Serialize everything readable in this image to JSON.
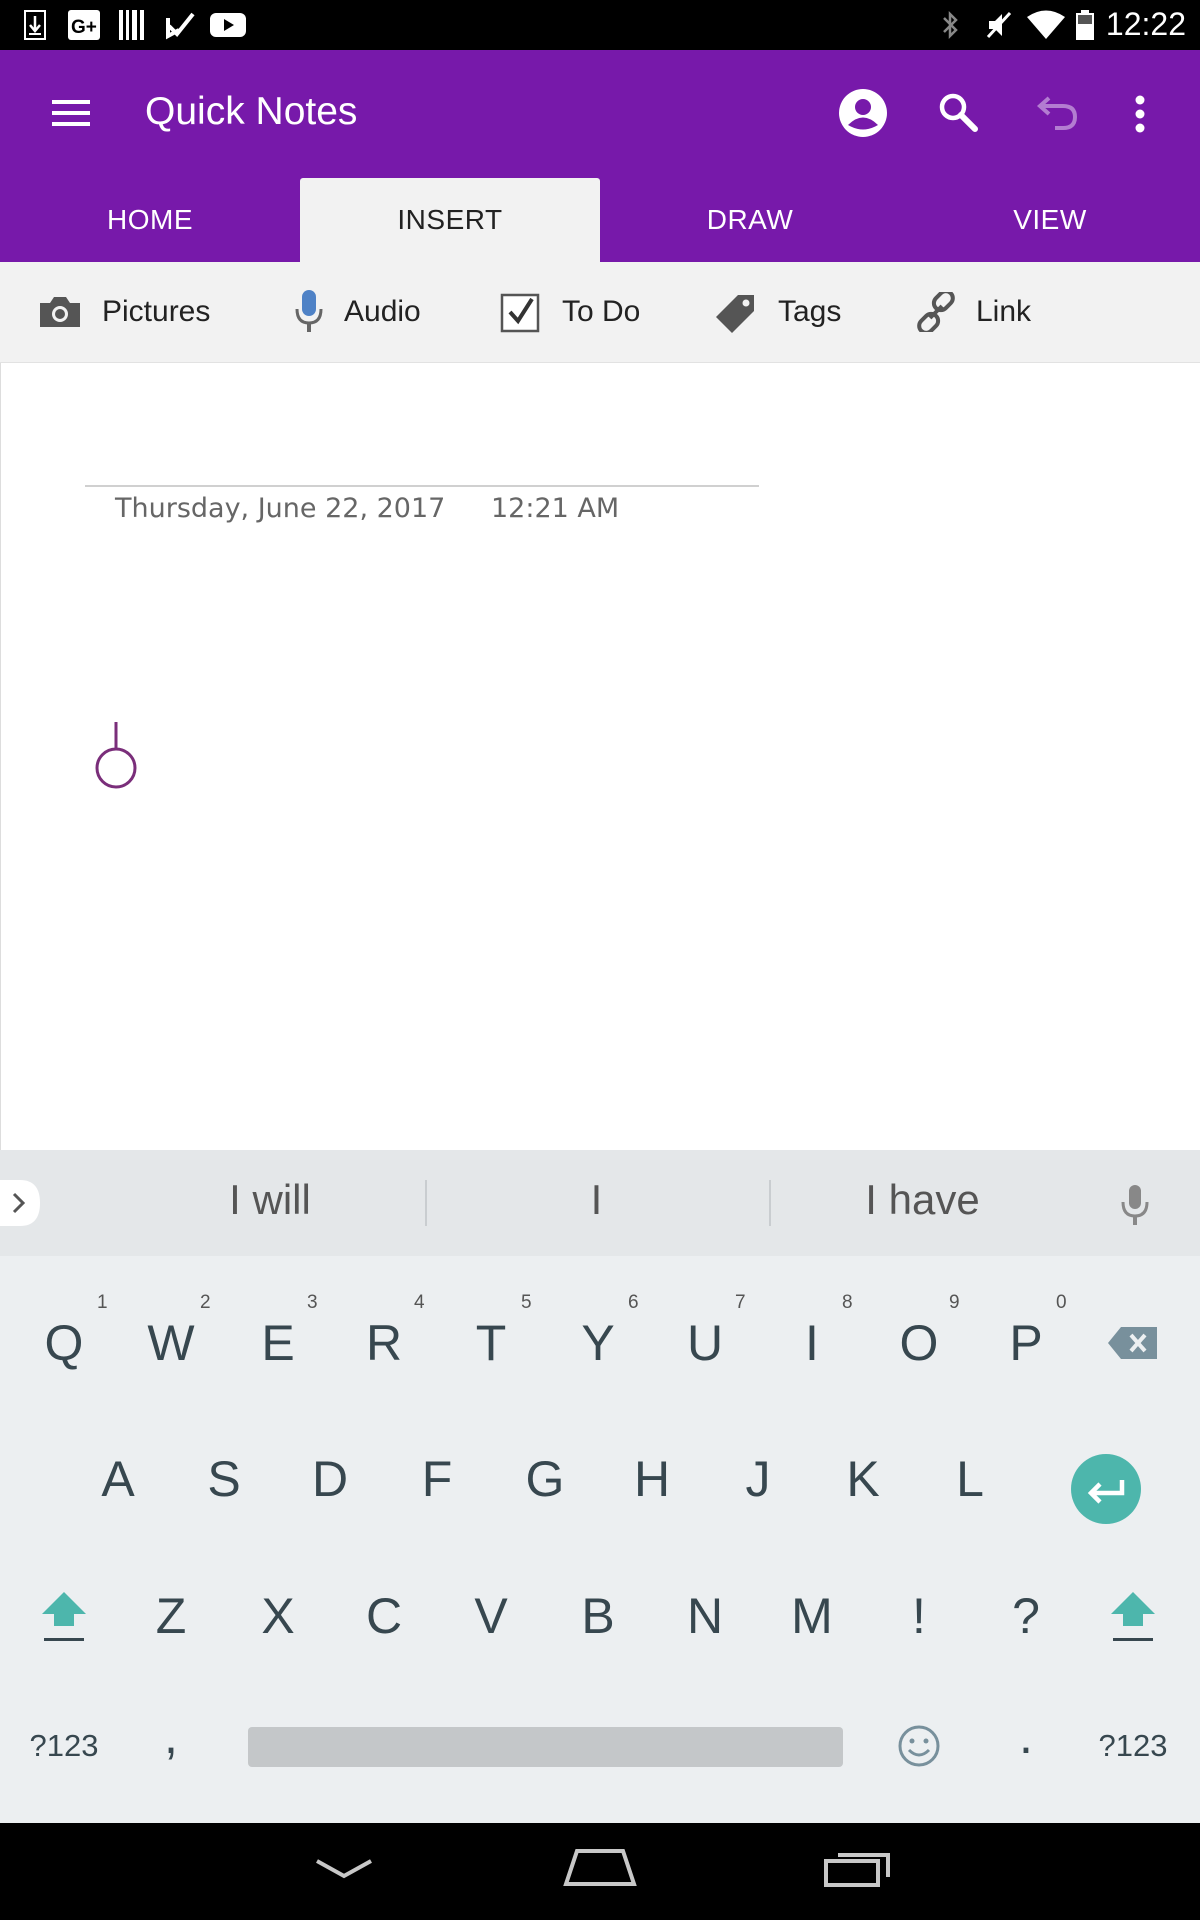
{
  "status_bar": {
    "time": "12:22",
    "left_icons": [
      "download-icon",
      "google-plus-icon",
      "barcode-icon",
      "check-icon",
      "youtube-icon"
    ],
    "right_icons": [
      "bluetooth-icon",
      "mute-icon",
      "wifi-icon",
      "battery-icon"
    ]
  },
  "app_bar": {
    "title": "Quick Notes",
    "color": "#7719AA"
  },
  "tabs": [
    {
      "label": "HOME",
      "active": false
    },
    {
      "label": "INSERT",
      "active": true
    },
    {
      "label": "DRAW",
      "active": false
    },
    {
      "label": "VIEW",
      "active": false
    }
  ],
  "ribbon": [
    {
      "label": "Pictures",
      "icon": "camera-icon"
    },
    {
      "label": "Audio",
      "icon": "microphone-icon"
    },
    {
      "label": "To Do",
      "icon": "checkbox-icon"
    },
    {
      "label": "Tags",
      "icon": "tag-icon"
    },
    {
      "label": "Link",
      "icon": "link-icon"
    }
  ],
  "note": {
    "date": "Thursday, June 22, 2017",
    "time": "12:21 AM"
  },
  "keyboard": {
    "suggestions": [
      "I will",
      "I",
      "I have"
    ],
    "row1": [
      "Q",
      "W",
      "E",
      "R",
      "T",
      "Y",
      "U",
      "I",
      "O",
      "P"
    ],
    "row1_hints": [
      "1",
      "2",
      "3",
      "4",
      "5",
      "6",
      "7",
      "8",
      "9",
      "0"
    ],
    "row2": [
      "A",
      "S",
      "D",
      "F",
      "G",
      "H",
      "J",
      "K",
      "L"
    ],
    "row3": [
      "Z",
      "X",
      "C",
      "V",
      "B",
      "N",
      "M",
      "!",
      "?"
    ],
    "symbols_label": "?123",
    "comma": ",",
    "period": ".",
    "accent_color": "#4DB6AC"
  }
}
